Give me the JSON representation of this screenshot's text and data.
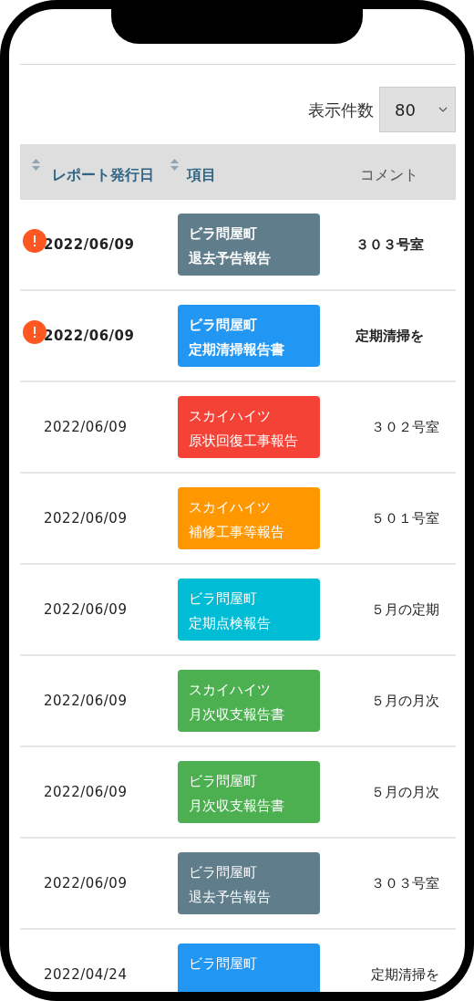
{
  "page_size": {
    "label": "表示件数",
    "value": "80"
  },
  "table": {
    "columns": [
      {
        "label": "レポート発行日",
        "sortable": true
      },
      {
        "label": "項目",
        "sortable": true
      },
      {
        "label": "コメント",
        "sortable": false
      }
    ],
    "rows": [
      {
        "date": "2022/06/09",
        "unread": true,
        "tag": {
          "building": "ビラ問屋町",
          "report": "退去予告報告",
          "color": "#607d8b"
        },
        "comment": "３０３号室"
      },
      {
        "date": "2022/06/09",
        "unread": true,
        "tag": {
          "building": "ビラ問屋町",
          "report": "定期清掃報告書",
          "color": "#2196f3"
        },
        "comment": "定期清掃を"
      },
      {
        "date": "2022/06/09",
        "unread": false,
        "tag": {
          "building": "スカイハイツ",
          "report": "原状回復工事報告",
          "color": "#f44336"
        },
        "comment": "３０２号室"
      },
      {
        "date": "2022/06/09",
        "unread": false,
        "tag": {
          "building": "スカイハイツ",
          "report": "補修工事等報告",
          "color": "#ff9800"
        },
        "comment": "５０１号室"
      },
      {
        "date": "2022/06/09",
        "unread": false,
        "tag": {
          "building": "ビラ問屋町",
          "report": "定期点検報告",
          "color": "#00bcd4"
        },
        "comment": "５月の定期"
      },
      {
        "date": "2022/06/09",
        "unread": false,
        "tag": {
          "building": "スカイハイツ",
          "report": "月次収支報告書",
          "color": "#4caf50"
        },
        "comment": "５月の月次"
      },
      {
        "date": "2022/06/09",
        "unread": false,
        "tag": {
          "building": "ビラ問屋町",
          "report": "月次収支報告書",
          "color": "#4caf50"
        },
        "comment": "５月の月次"
      },
      {
        "date": "2022/06/09",
        "unread": false,
        "tag": {
          "building": "ビラ問屋町",
          "report": "退去予告報告",
          "color": "#607d8b"
        },
        "comment": "３０３号室"
      },
      {
        "date": "2022/04/24",
        "unread": false,
        "tag": {
          "building": "ビラ問屋町",
          "color": "#2196f3"
        },
        "comment": "定期清掃を"
      }
    ]
  }
}
